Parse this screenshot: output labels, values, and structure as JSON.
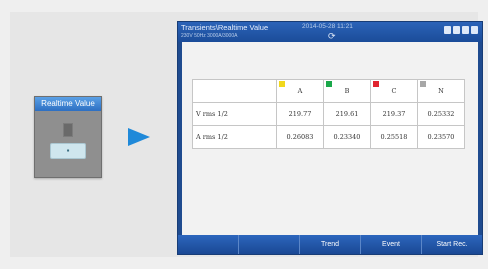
{
  "widget": {
    "title": "Realtime Value",
    "button_glyph": "▪"
  },
  "device": {
    "header": {
      "title": "Transients\\Realtime Value",
      "datetime": "2014-05-28 11:21",
      "subtitle": "230V 50Hz  3000A/3000A",
      "refresh_icon": "⟳"
    },
    "table": {
      "columns": [
        {
          "label": "A",
          "color": "#f1d81c"
        },
        {
          "label": "B",
          "color": "#1aa84a"
        },
        {
          "label": "C",
          "color": "#e0242f"
        },
        {
          "label": "N",
          "color": "#a7a7a7"
        }
      ],
      "rows": [
        {
          "label": "V rms 1/2",
          "values": [
            "219.77",
            "219.61",
            "219.37",
            "0.25332"
          ]
        },
        {
          "label": "A rms 1/2",
          "values": [
            "0.26083",
            "0.23340",
            "0.25518",
            "0.23570"
          ]
        }
      ]
    },
    "footer": {
      "buttons": [
        "",
        "",
        "Trend",
        "Event",
        "Start Rec."
      ]
    }
  }
}
